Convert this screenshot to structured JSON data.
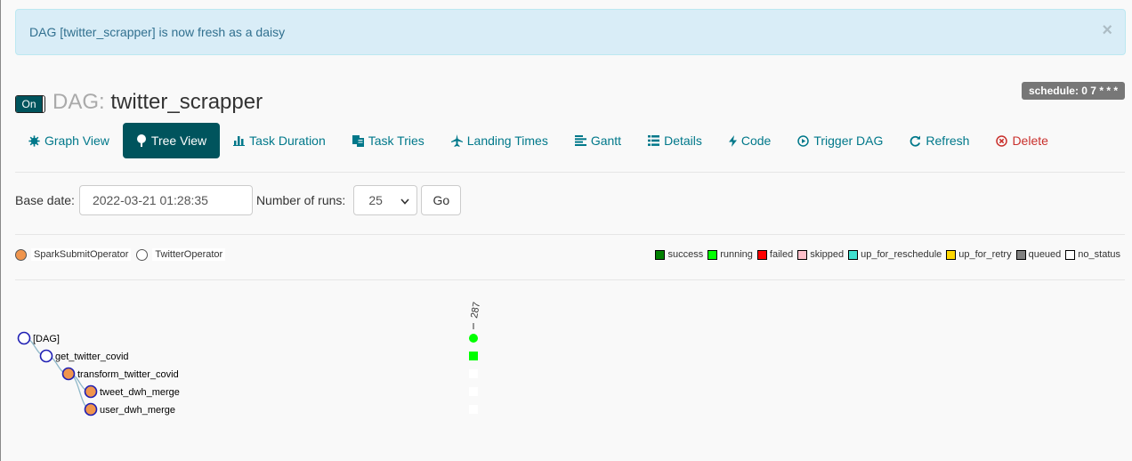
{
  "alert": {
    "message": "DAG [twitter_scrapper] is now fresh as a daisy",
    "close": "×"
  },
  "dag": {
    "toggle_label": "On",
    "prefix": "DAG:",
    "name": "twitter_scrapper",
    "schedule": "schedule: 0 7 * * *"
  },
  "nav": [
    {
      "label": "Graph View",
      "icon": "gear-icon"
    },
    {
      "label": "Tree View",
      "icon": "tree-icon",
      "active": true
    },
    {
      "label": "Task Duration",
      "icon": "bar-chart-icon"
    },
    {
      "label": "Task Tries",
      "icon": "copy-icon"
    },
    {
      "label": "Landing Times",
      "icon": "plane-icon"
    },
    {
      "label": "Gantt",
      "icon": "align-left-icon"
    },
    {
      "label": "Details",
      "icon": "list-icon"
    },
    {
      "label": "Code",
      "icon": "bolt-icon"
    },
    {
      "label": "Trigger DAG",
      "icon": "play-circle-icon"
    },
    {
      "label": "Refresh",
      "icon": "refresh-icon"
    },
    {
      "label": "Delete",
      "icon": "delete-circle-icon"
    }
  ],
  "form": {
    "base_date_label": "Base date:",
    "base_date_value": "2022-03-21 01:28:35",
    "runs_label": "Number of runs:",
    "runs_value": "25",
    "go_label": "Go"
  },
  "operators": [
    {
      "name": "SparkSubmitOperator",
      "color": "#f0954d"
    },
    {
      "name": "TwitterOperator",
      "color": "#ffffff"
    }
  ],
  "states": [
    {
      "name": "success",
      "color": "#008000"
    },
    {
      "name": "running",
      "color": "#00ff00"
    },
    {
      "name": "failed",
      "color": "#ff0000"
    },
    {
      "name": "skipped",
      "color": "#ffc0cb"
    },
    {
      "name": "up_for_reschedule",
      "color": "#40e0d0"
    },
    {
      "name": "up_for_retry",
      "color": "#ffd700"
    },
    {
      "name": "queued",
      "color": "#808080"
    },
    {
      "name": "no_status",
      "color": "#ffffff"
    }
  ],
  "tree": {
    "run_label": "287",
    "nodes": [
      {
        "label": "[DAG]",
        "depth": 0,
        "color": "#ffffff",
        "state_color": "#00ff00",
        "state_shape": "circle"
      },
      {
        "label": "get_twitter_covid",
        "depth": 1,
        "color": "#ffffff",
        "state_color": "#00ff00",
        "state_shape": "square"
      },
      {
        "label": "transform_twitter_covid",
        "depth": 2,
        "color": "#f0954d",
        "state_color": "#ffffff",
        "state_shape": "square"
      },
      {
        "label": "tweet_dwh_merge",
        "depth": 3,
        "color": "#f0954d",
        "state_color": "#ffffff",
        "state_shape": "square"
      },
      {
        "label": "user_dwh_merge",
        "depth": 3,
        "color": "#f0954d",
        "state_color": "#ffffff",
        "state_shape": "square"
      }
    ]
  }
}
